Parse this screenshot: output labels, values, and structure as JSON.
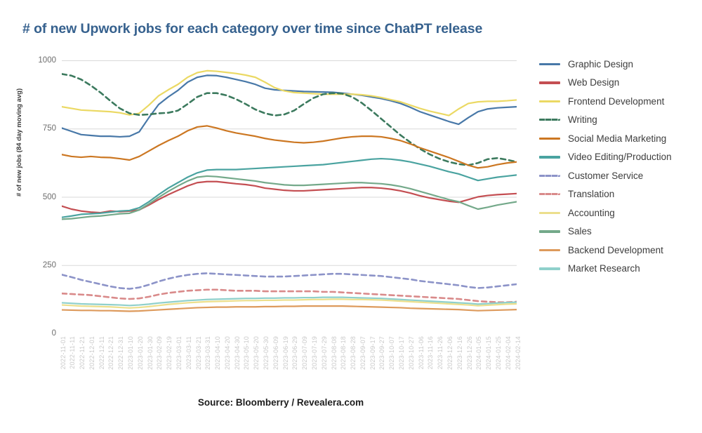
{
  "title": "# of new Upwork jobs for each category over time since ChatPT release",
  "title_color": "#36618e",
  "source_note": "Source: Bloomberry / Revealera.com",
  "y_axis_title": "# of new jobs (84 day moving avg)",
  "y_ticks": [
    "0",
    "250",
    "500",
    "750",
    "1000"
  ],
  "legend": [
    {
      "label": "Graphic Design",
      "color": "#4878a8",
      "dashed": false
    },
    {
      "label": "Web Design",
      "color": "#c44e52",
      "dashed": false
    },
    {
      "label": "Frontend Development",
      "color": "#ebd964",
      "dashed": false
    },
    {
      "label": "Writing",
      "color": "#3c7a5e",
      "dashed": true
    },
    {
      "label": "Social Media Marketing",
      "color": "#cc7722",
      "dashed": false
    },
    {
      "label": "Video Editing/Production",
      "color": "#4aa3a0",
      "dashed": false
    },
    {
      "label": "Customer Service",
      "color": "#8c93c8",
      "dashed": true
    },
    {
      "label": "Translation",
      "color": "#d98a8a",
      "dashed": true
    },
    {
      "label": "Accounting",
      "color": "#ecdf8c",
      "dashed": false
    },
    {
      "label": "Sales",
      "color": "#74a98a",
      "dashed": false
    },
    {
      "label": "Backend Development",
      "color": "#dd9a5c",
      "dashed": false
    },
    {
      "label": "Market Research",
      "color": "#8fd0cb",
      "dashed": false
    }
  ],
  "chart_data": {
    "type": "line",
    "title": "# of new Upwork jobs for each category over time since ChatPT release",
    "xlabel": "",
    "ylabel": "# of new jobs (84 day moving avg)",
    "ylim": [
      0,
      1000
    ],
    "yticks": [
      0,
      250,
      500,
      750,
      1000
    ],
    "grid": true,
    "legend_position": "right",
    "x": [
      "2022-11-01",
      "2022-11-11",
      "2022-11-21",
      "2022-12-01",
      "2022-12-11",
      "2022-12-21",
      "2022-12-31",
      "2023-01-10",
      "2023-01-20",
      "2023-01-30",
      "2023-02-09",
      "2023-02-19",
      "2023-03-01",
      "2023-03-11",
      "2023-03-21",
      "2023-03-31",
      "2023-04-10",
      "2023-04-20",
      "2023-04-30",
      "2023-05-10",
      "2023-05-20",
      "2023-05-30",
      "2023-06-09",
      "2023-06-19",
      "2023-06-29",
      "2023-07-09",
      "2023-07-19",
      "2023-07-29",
      "2023-08-08",
      "2023-08-18",
      "2023-08-28",
      "2023-09-07",
      "2023-09-17",
      "2023-09-27",
      "2023-10-07",
      "2023-10-17",
      "2023-10-27",
      "2023-11-06",
      "2023-11-16",
      "2023-11-26",
      "2023-12-06",
      "2023-12-16",
      "2023-12-26",
      "2024-01-05",
      "2024-01-15",
      "2024-01-25",
      "2024-02-04",
      "2024-02-14"
    ],
    "series": [
      {
        "name": "Graphic Design",
        "color": "#4878a8",
        "dashed": false,
        "values": [
          752,
          740,
          728,
          725,
          722,
          722,
          720,
          722,
          738,
          790,
          838,
          866,
          890,
          920,
          938,
          945,
          944,
          938,
          930,
          922,
          912,
          898,
          892,
          890,
          888,
          886,
          885,
          884,
          883,
          880,
          876,
          872,
          866,
          860,
          852,
          842,
          828,
          812,
          800,
          788,
          776,
          766,
          790,
          812,
          822,
          826,
          828,
          830
        ]
      },
      {
        "name": "Web Design",
        "color": "#c44e52",
        "dashed": false,
        "values": [
          466,
          455,
          448,
          444,
          442,
          448,
          446,
          448,
          452,
          470,
          490,
          508,
          524,
          540,
          552,
          556,
          556,
          552,
          548,
          545,
          540,
          532,
          528,
          524,
          522,
          522,
          524,
          526,
          528,
          530,
          532,
          534,
          534,
          532,
          528,
          522,
          514,
          504,
          496,
          490,
          484,
          480,
          490,
          500,
          505,
          508,
          510,
          512
        ]
      },
      {
        "name": "Frontend Development",
        "color": "#ebd964",
        "dashed": false,
        "values": [
          830,
          824,
          818,
          816,
          814,
          812,
          808,
          800,
          806,
          836,
          870,
          892,
          912,
          938,
          955,
          962,
          960,
          956,
          952,
          946,
          938,
          920,
          900,
          888,
          882,
          880,
          878,
          876,
          876,
          876,
          876,
          874,
          870,
          864,
          856,
          848,
          836,
          824,
          814,
          806,
          798,
          822,
          842,
          848,
          850,
          850,
          852,
          855
        ]
      },
      {
        "name": "Writing",
        "color": "#3c7a5e",
        "dashed": true,
        "values": [
          950,
          944,
          930,
          908,
          882,
          852,
          824,
          806,
          800,
          802,
          806,
          808,
          816,
          840,
          866,
          880,
          880,
          872,
          858,
          840,
          820,
          806,
          798,
          802,
          816,
          840,
          862,
          876,
          880,
          878,
          866,
          844,
          816,
          786,
          756,
          726,
          700,
          676,
          656,
          640,
          628,
          620,
          616,
          624,
          638,
          642,
          636,
          628
        ]
      },
      {
        "name": "Social Media Marketing",
        "color": "#cc7722",
        "dashed": false,
        "values": [
          655,
          648,
          645,
          648,
          645,
          644,
          640,
          635,
          648,
          668,
          688,
          706,
          722,
          742,
          756,
          760,
          752,
          742,
          734,
          728,
          722,
          714,
          708,
          704,
          700,
          698,
          700,
          704,
          710,
          716,
          720,
          722,
          722,
          720,
          714,
          706,
          694,
          680,
          668,
          656,
          644,
          630,
          616,
          606,
          610,
          618,
          624,
          628
        ]
      },
      {
        "name": "Video Editing/Production",
        "color": "#4aa3a0",
        "dashed": false,
        "values": [
          425,
          430,
          436,
          438,
          440,
          444,
          448,
          450,
          460,
          482,
          508,
          532,
          552,
          572,
          588,
          598,
          600,
          600,
          600,
          602,
          604,
          606,
          608,
          610,
          612,
          614,
          616,
          618,
          622,
          626,
          630,
          634,
          638,
          640,
          638,
          634,
          628,
          620,
          612,
          602,
          592,
          584,
          572,
          560,
          566,
          572,
          576,
          580
        ]
      },
      {
        "name": "Customer Service",
        "color": "#8c93c8",
        "dashed": true,
        "values": [
          215,
          206,
          196,
          188,
          180,
          172,
          166,
          163,
          168,
          178,
          190,
          200,
          208,
          214,
          218,
          220,
          218,
          216,
          214,
          212,
          210,
          208,
          208,
          208,
          210,
          212,
          214,
          216,
          218,
          218,
          216,
          214,
          212,
          210,
          206,
          202,
          198,
          192,
          188,
          184,
          180,
          176,
          170,
          166,
          168,
          172,
          176,
          180
        ]
      },
      {
        "name": "Translation",
        "color": "#d98a8a",
        "dashed": true,
        "values": [
          146,
          144,
          142,
          140,
          136,
          132,
          128,
          126,
          128,
          134,
          142,
          148,
          152,
          156,
          158,
          160,
          160,
          158,
          156,
          156,
          156,
          154,
          154,
          154,
          154,
          154,
          154,
          152,
          152,
          150,
          148,
          146,
          144,
          142,
          140,
          138,
          136,
          134,
          132,
          130,
          128,
          126,
          122,
          118,
          116,
          114,
          114,
          116
        ]
      },
      {
        "name": "Accounting",
        "color": "#ecdf8c",
        "dashed": false,
        "values": [
          104,
          102,
          100,
          99,
          98,
          97,
          95,
          93,
          95,
          98,
          102,
          106,
          109,
          112,
          114,
          116,
          117,
          118,
          119,
          120,
          120,
          121,
          121,
          122,
          122,
          123,
          124,
          124,
          125,
          125,
          124,
          124,
          123,
          122,
          120,
          118,
          116,
          114,
          112,
          110,
          108,
          106,
          104,
          101,
          103,
          105,
          107,
          108
        ]
      },
      {
        "name": "Sales",
        "color": "#74a98a",
        "dashed": false,
        "values": [
          418,
          420,
          424,
          428,
          430,
          434,
          438,
          440,
          452,
          474,
          498,
          520,
          540,
          558,
          572,
          576,
          574,
          570,
          566,
          562,
          558,
          552,
          548,
          544,
          542,
          542,
          544,
          546,
          548,
          550,
          552,
          552,
          550,
          548,
          544,
          538,
          530,
          520,
          510,
          500,
          490,
          482,
          468,
          455,
          462,
          470,
          476,
          482
        ]
      },
      {
        "name": "Backend Development",
        "color": "#dd9a5c",
        "dashed": false,
        "values": [
          86,
          85,
          84,
          84,
          83,
          83,
          82,
          81,
          82,
          84,
          86,
          88,
          90,
          92,
          94,
          95,
          96,
          96,
          97,
          97,
          97,
          98,
          98,
          99,
          99,
          100,
          100,
          100,
          100,
          100,
          99,
          98,
          97,
          96,
          95,
          94,
          92,
          91,
          90,
          89,
          88,
          87,
          85,
          83,
          84,
          85,
          86,
          87
        ]
      },
      {
        "name": "Market Research",
        "color": "#8fd0cb",
        "dashed": false,
        "values": [
          112,
          110,
          108,
          107,
          106,
          105,
          104,
          102,
          104,
          107,
          111,
          114,
          117,
          120,
          122,
          124,
          125,
          126,
          127,
          128,
          128,
          129,
          129,
          130,
          130,
          131,
          131,
          132,
          132,
          132,
          131,
          130,
          129,
          128,
          126,
          124,
          122,
          120,
          118,
          116,
          114,
          112,
          110,
          107,
          109,
          111,
          113,
          114
        ]
      }
    ]
  }
}
